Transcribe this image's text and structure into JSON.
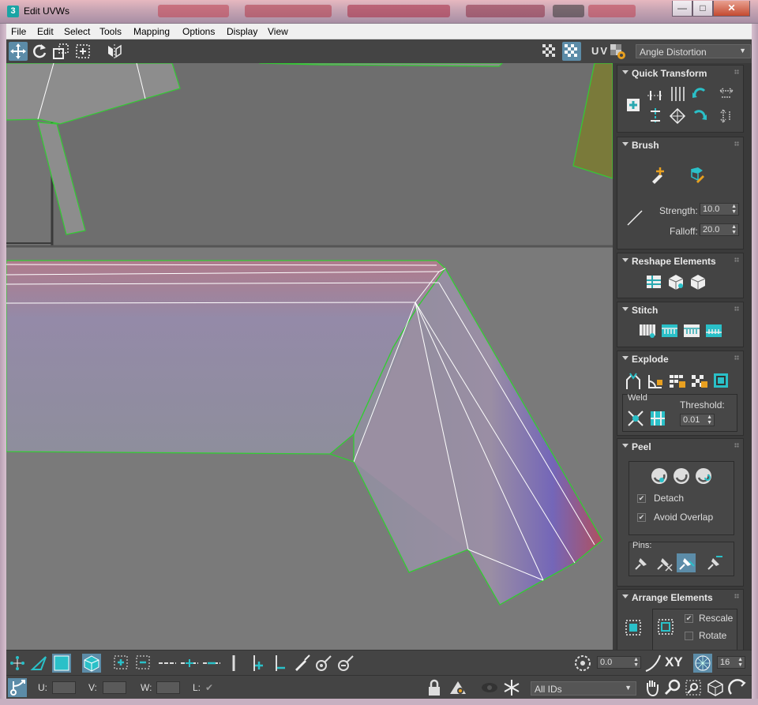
{
  "window": {
    "title": "Edit UVWs",
    "app_icon_label": "3",
    "minimize_label": "—",
    "maximize_label": "□",
    "close_label": "✕"
  },
  "menu": [
    "File",
    "Edit",
    "Select",
    "Tools",
    "Mapping",
    "Options",
    "Display",
    "View"
  ],
  "toolbar": {
    "tools": [
      "move-icon",
      "rotate-icon",
      "scale-icon",
      "freeform-icon",
      "mirror-icon"
    ],
    "right_tools": [
      "checker-pattern-icon",
      "checker-active-icon"
    ],
    "uv_label": "UV",
    "display_icon": "texture-settings-icon",
    "dropdown_value": "Angle Distortion"
  },
  "panel": {
    "quick_transform": {
      "title": "Quick Transform"
    },
    "brush": {
      "title": "Brush",
      "strength_label": "Strength:",
      "strength_value": "10.0",
      "falloff_label": "Falloff:",
      "falloff_value": "20.0"
    },
    "reshape": {
      "title": "Reshape Elements"
    },
    "stitch": {
      "title": "Stitch"
    },
    "explode": {
      "title": "Explode",
      "weld_label": "Weld",
      "threshold_label": "Threshold:",
      "threshold_value": "0.01"
    },
    "peel": {
      "title": "Peel",
      "detach_label": "Detach",
      "detach_checked": true,
      "avoid_overlap_label": "Avoid Overlap",
      "avoid_overlap_checked": true,
      "pins_label": "Pins:"
    },
    "arrange": {
      "title": "Arrange Elements",
      "rescale_label": "Rescale",
      "rescale_checked": true,
      "rotate_label": "Rotate",
      "rotate_checked": false
    }
  },
  "bottom": {
    "rotate_value": "0.0",
    "xy_label": "XY",
    "grid_value": "16",
    "u_label": "U:",
    "v_label": "V:",
    "w_label": "W:",
    "l_label": "L:",
    "id_filter": "All IDs",
    "check_mark": "✔"
  },
  "colors": {
    "accent": "#3fc1c9",
    "selection_edge": "#22cc22",
    "viewport_bg": "#7a7a7a",
    "panel_bg": "#444444"
  }
}
